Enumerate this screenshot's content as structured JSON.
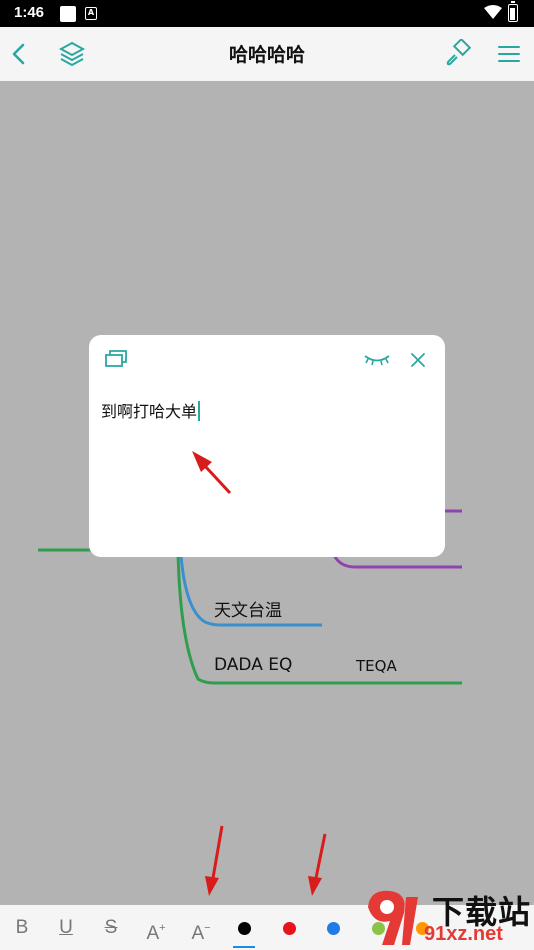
{
  "status_bar": {
    "time": "1:46",
    "app_icon_letter": "A"
  },
  "app_bar": {
    "title": "哈哈哈哈",
    "accent": "#2aa8a0"
  },
  "mind_map": {
    "nodes": [
      {
        "label": "天文台温"
      },
      {
        "label": "DADA EQ"
      },
      {
        "label": "TEQA"
      }
    ],
    "branch_colors": {
      "green": "#2e9e4e",
      "blue": "#3a8fd0",
      "purple": "#8e44ad"
    }
  },
  "dialog": {
    "text": "到啊打哈大单"
  },
  "toolbar": {
    "bold": "B",
    "underline": "U",
    "strike": "S",
    "font_up": "A",
    "font_up_sup": "+",
    "font_down": "A",
    "font_down_sup": "−",
    "colors": [
      "#000000",
      "#e8141a",
      "#1e7be8",
      "#8bc34a",
      "#ff9800"
    ],
    "selected_color_index": 0
  },
  "watermark": {
    "brand": "下载站",
    "url": "91xz.net"
  }
}
